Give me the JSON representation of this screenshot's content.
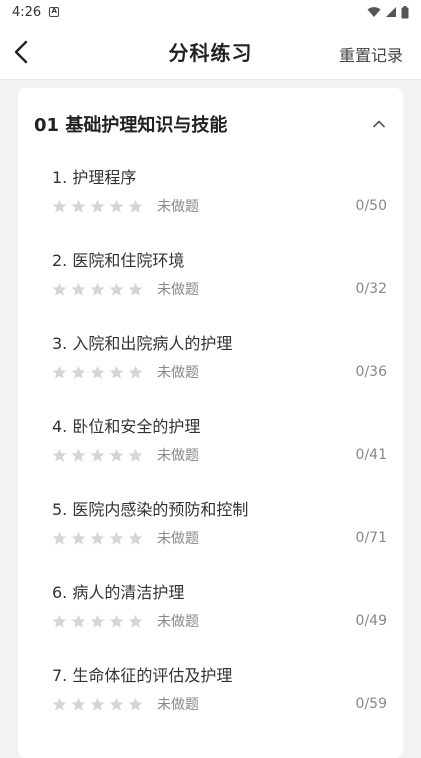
{
  "status_bar": {
    "time": "4:26",
    "notif_letter": "A"
  },
  "header": {
    "title": "分科练习",
    "reset_label": "重置记录"
  },
  "section": {
    "title": "01 基础护理知识与技能",
    "items": [
      {
        "title": "1. 护理程序",
        "status": "未做题",
        "count": "0/50",
        "stars": 0
      },
      {
        "title": "2. 医院和住院环境",
        "status": "未做题",
        "count": "0/32",
        "stars": 0
      },
      {
        "title": "3. 入院和出院病人的护理",
        "status": "未做题",
        "count": "0/36",
        "stars": 0
      },
      {
        "title": "4. 卧位和安全的护理",
        "status": "未做题",
        "count": "0/41",
        "stars": 0
      },
      {
        "title": "5. 医院内感染的预防和控制",
        "status": "未做题",
        "count": "0/71",
        "stars": 0
      },
      {
        "title": "6. 病人的清洁护理",
        "status": "未做题",
        "count": "0/49",
        "stars": 0
      },
      {
        "title": "7. 生命体征的评估及护理",
        "status": "未做题",
        "count": "0/59",
        "stars": 0
      }
    ]
  },
  "colors": {
    "star_empty": "#d6d6d6",
    "accent_text": "#222222",
    "muted_text": "#888888"
  }
}
